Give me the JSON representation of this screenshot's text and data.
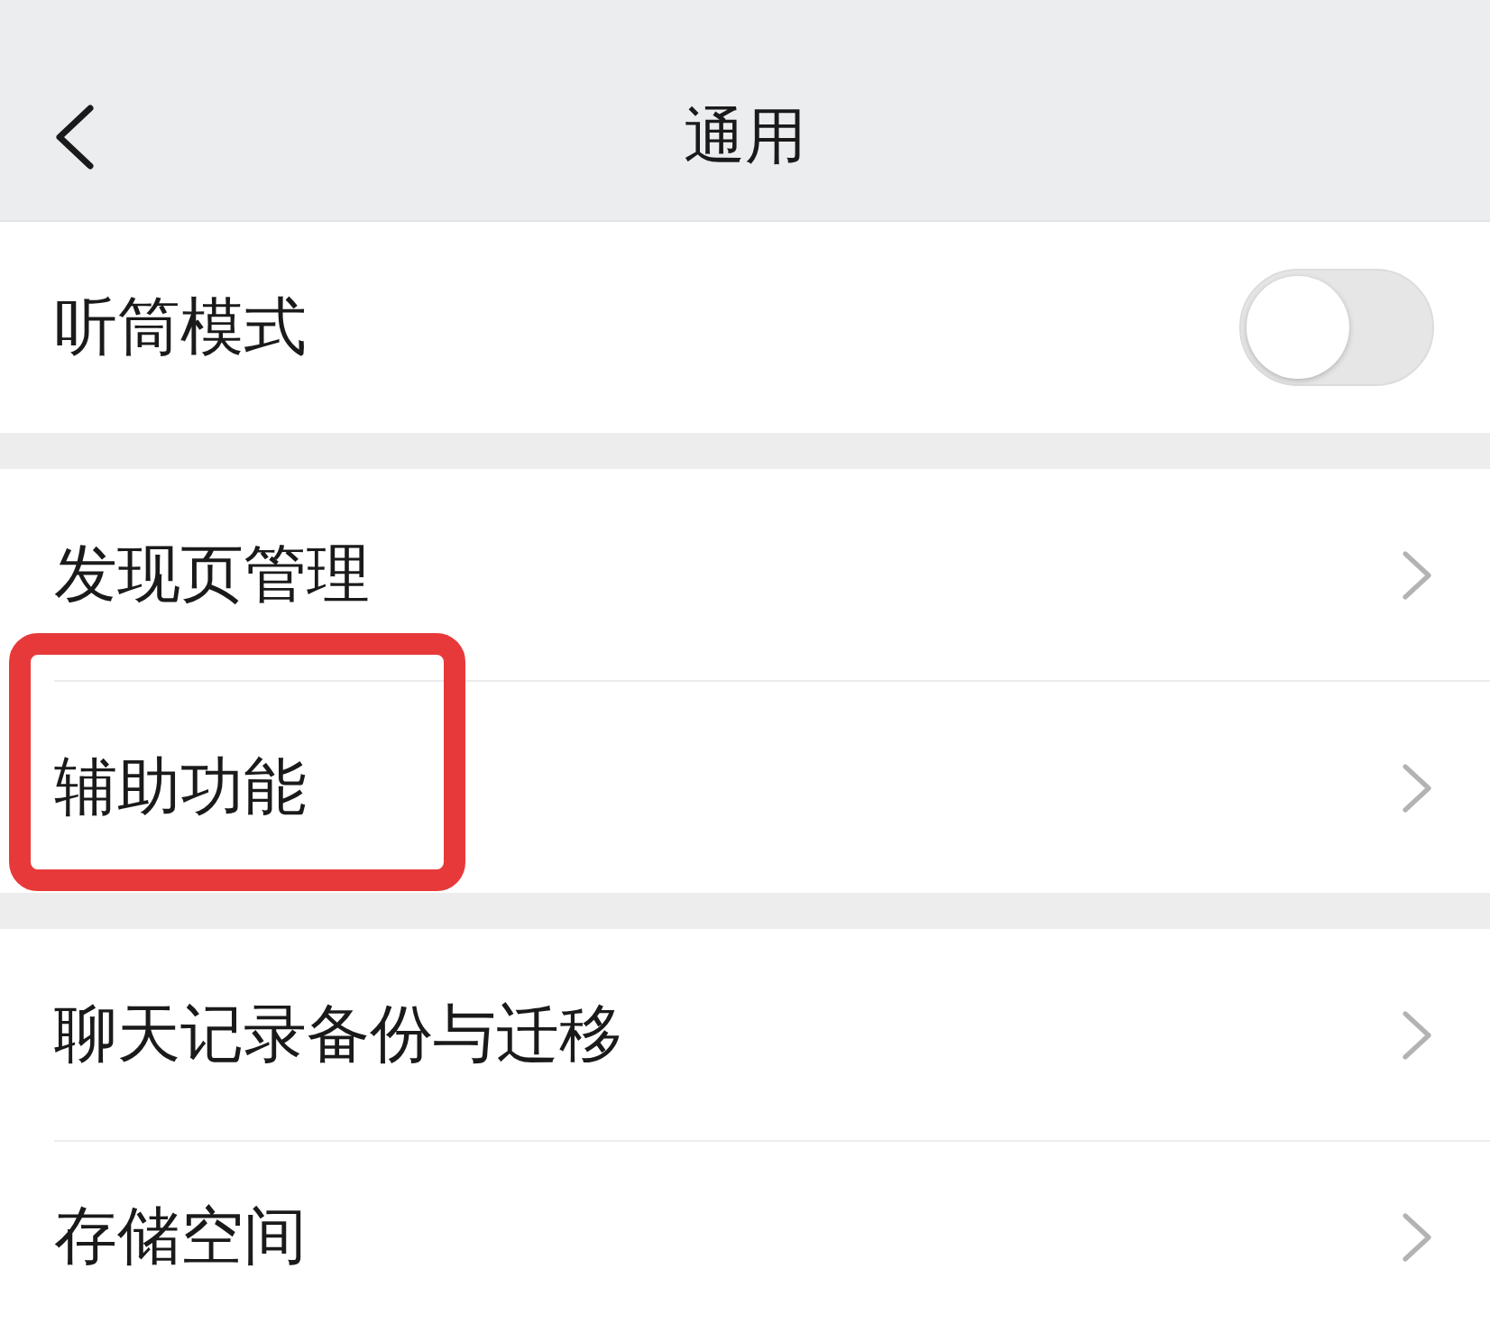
{
  "header": {
    "title": "通用"
  },
  "groups": [
    {
      "items": [
        {
          "kind": "toggle",
          "label": "听筒模式",
          "on": false,
          "highlighted": false
        }
      ]
    },
    {
      "items": [
        {
          "kind": "link",
          "label": "发现页管理",
          "highlighted": false
        },
        {
          "kind": "link",
          "label": "辅助功能",
          "highlighted": true
        }
      ]
    },
    {
      "items": [
        {
          "kind": "link",
          "label": "聊天记录备份与迁移",
          "highlighted": false
        },
        {
          "kind": "link",
          "label": "存储空间",
          "highlighted": false
        }
      ]
    }
  ]
}
